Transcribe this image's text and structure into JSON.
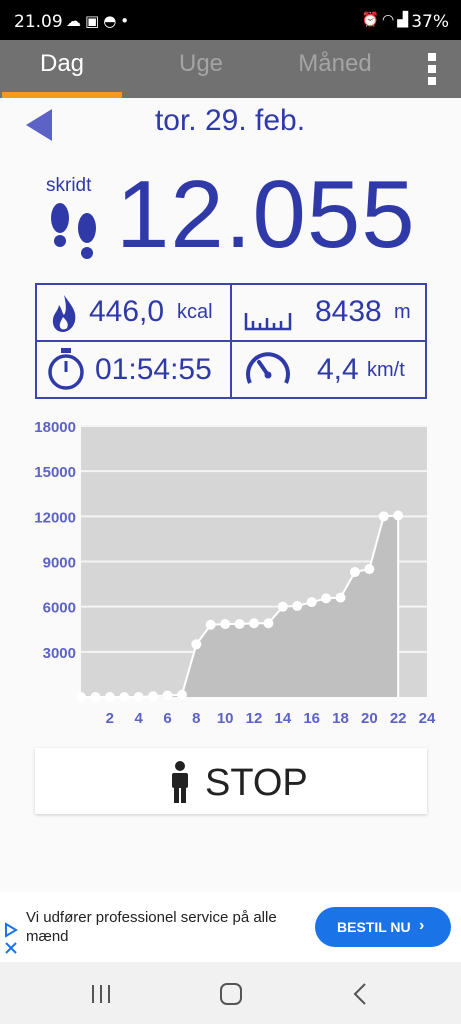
{
  "status_bar": {
    "time": "21.09",
    "battery": "37%",
    "icons": [
      "cloud-icon",
      "gallery-icon",
      "weather-icon",
      "dot-icon",
      "alarm-icon",
      "wifi-icon",
      "signal-icon"
    ]
  },
  "tabs": [
    {
      "label": "Dag",
      "active": true
    },
    {
      "label": "Uge",
      "active": false
    },
    {
      "label": "Måned",
      "active": false
    }
  ],
  "day": {
    "date": "tor. 29. feb.",
    "steps_label": "skridt",
    "steps": "12.055"
  },
  "stats": {
    "calories": {
      "value": "446,0",
      "unit": "kcal"
    },
    "distance": {
      "value": "8438",
      "unit": "m"
    },
    "duration": {
      "value": "01:54:55"
    },
    "speed": {
      "value": "4,4",
      "unit": "km/t"
    }
  },
  "chart_data": {
    "type": "area",
    "x": [
      0,
      1,
      2,
      3,
      4,
      5,
      6,
      7,
      8,
      9,
      10,
      11,
      12,
      13,
      14,
      15,
      16,
      17,
      18,
      19,
      20,
      21,
      22
    ],
    "y": [
      0,
      0,
      0,
      0,
      0,
      50,
      100,
      150,
      3500,
      4800,
      4850,
      4850,
      4900,
      4900,
      6000,
      6050,
      6300,
      6550,
      6600,
      8300,
      8500,
      12000,
      12055
    ],
    "xlim": [
      0,
      24
    ],
    "ylim": [
      0,
      18000
    ],
    "x_ticks": [
      "2",
      "4",
      "6",
      "8",
      "10",
      "12",
      "14",
      "16",
      "18",
      "20",
      "22",
      "24"
    ],
    "y_ticks": [
      "3000",
      "6000",
      "9000",
      "12000",
      "15000",
      "18000"
    ],
    "grid": true,
    "colors": {
      "area": "#c0c0c0",
      "line": "#ffffff",
      "axis_text": "#5d62c6"
    }
  },
  "stop_button": {
    "label": "STOP"
  },
  "ad": {
    "text": "Vi udfører professionel service på alle mænd",
    "cta": "BESTIL NU"
  },
  "colors": {
    "accent": "#2f3aa8",
    "tab_indicator": "#f39a1d",
    "tab_bar": "#717171",
    "ad_button": "#1b73e8"
  }
}
